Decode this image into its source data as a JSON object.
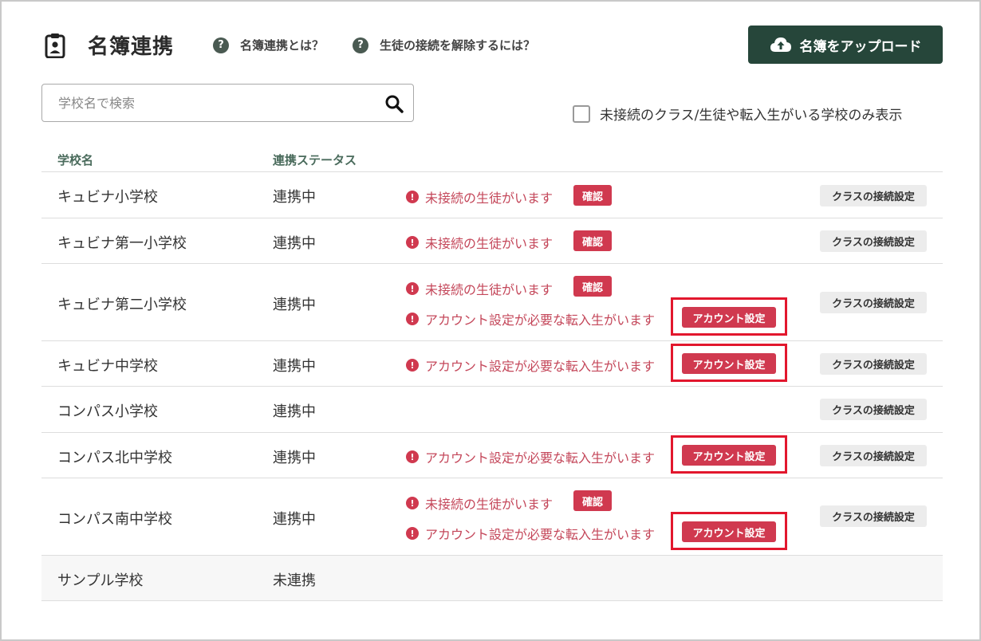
{
  "header": {
    "title": "名簿連携",
    "help_links": [
      "名簿連携とは？",
      "生徒の接続を解除するには？"
    ],
    "upload_label": "名簿をアップロード"
  },
  "search": {
    "placeholder": "学校名で検索"
  },
  "filter": {
    "label": "未接続のクラス/生徒や転入生がいる学校のみ表示",
    "checked": false
  },
  "table": {
    "headers": {
      "school": "学校名",
      "status": "連携ステータス"
    },
    "messages": {
      "unconnected": "未接続の生徒がいます",
      "transfer": "アカウント設定が必要な転入生がいます"
    },
    "buttons": {
      "confirm": "確認",
      "account": "アカウント設定",
      "class_setting": "クラスの接続設定"
    },
    "rows": [
      {
        "name": "キュビナ小学校",
        "status": "連携中"
      },
      {
        "name": "キュビナ第一小学校",
        "status": "連携中"
      },
      {
        "name": "キュビナ第二小学校",
        "status": "連携中"
      },
      {
        "name": "キュビナ中学校",
        "status": "連携中"
      },
      {
        "name": "コンパス小学校",
        "status": "連携中"
      },
      {
        "name": "コンパス北中学校",
        "status": "連携中"
      },
      {
        "name": "コンパス南中学校",
        "status": "連携中"
      },
      {
        "name": "サンプル学校",
        "status": "未連携"
      }
    ]
  },
  "colors": {
    "brand": "#26463a",
    "alert": "#d0394f",
    "highlight": "#e2172d"
  }
}
